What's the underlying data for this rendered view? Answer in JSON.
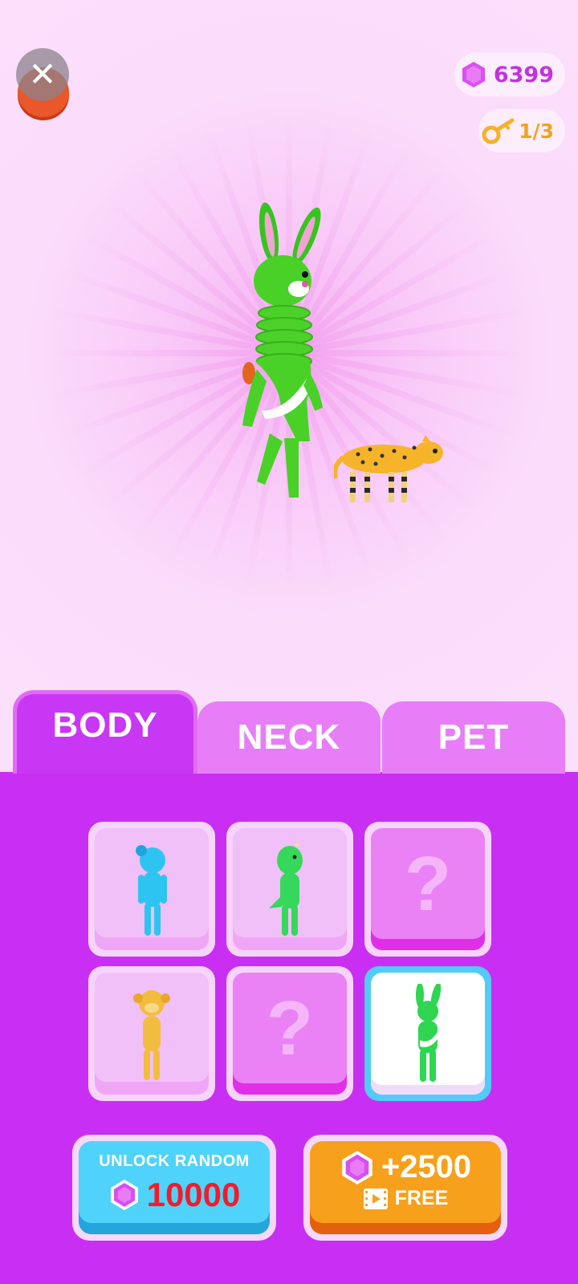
{
  "hud": {
    "gems": "6399",
    "keys": "1/3",
    "close_icon": "close-icon"
  },
  "tabs": [
    {
      "label": "BODY",
      "active": true
    },
    {
      "label": "NECK",
      "active": false
    },
    {
      "label": "PET",
      "active": false
    }
  ],
  "skins": [
    {
      "name": "blue-girl",
      "state": "owned",
      "color": "#2ec4f2"
    },
    {
      "name": "green-dino",
      "state": "owned",
      "color": "#35d85a"
    },
    {
      "name": "unknown",
      "state": "locked",
      "label": "?"
    },
    {
      "name": "yellow-monkey",
      "state": "owned",
      "color": "#f2bd3e"
    },
    {
      "name": "unknown",
      "state": "locked",
      "label": "?"
    },
    {
      "name": "green-bunny",
      "state": "selected",
      "color": "#2fd651"
    }
  ],
  "buttons": {
    "unlock_random_label": "UNLOCK RANDOM",
    "unlock_random_cost": "10000",
    "free_gems_amount": "+2500",
    "free_label": "FREE"
  },
  "colors": {
    "gem": "#d94ff0",
    "panel": "#c92ff2",
    "tab_active": "#c838f4",
    "tab_inactive": "#e77ef8"
  }
}
